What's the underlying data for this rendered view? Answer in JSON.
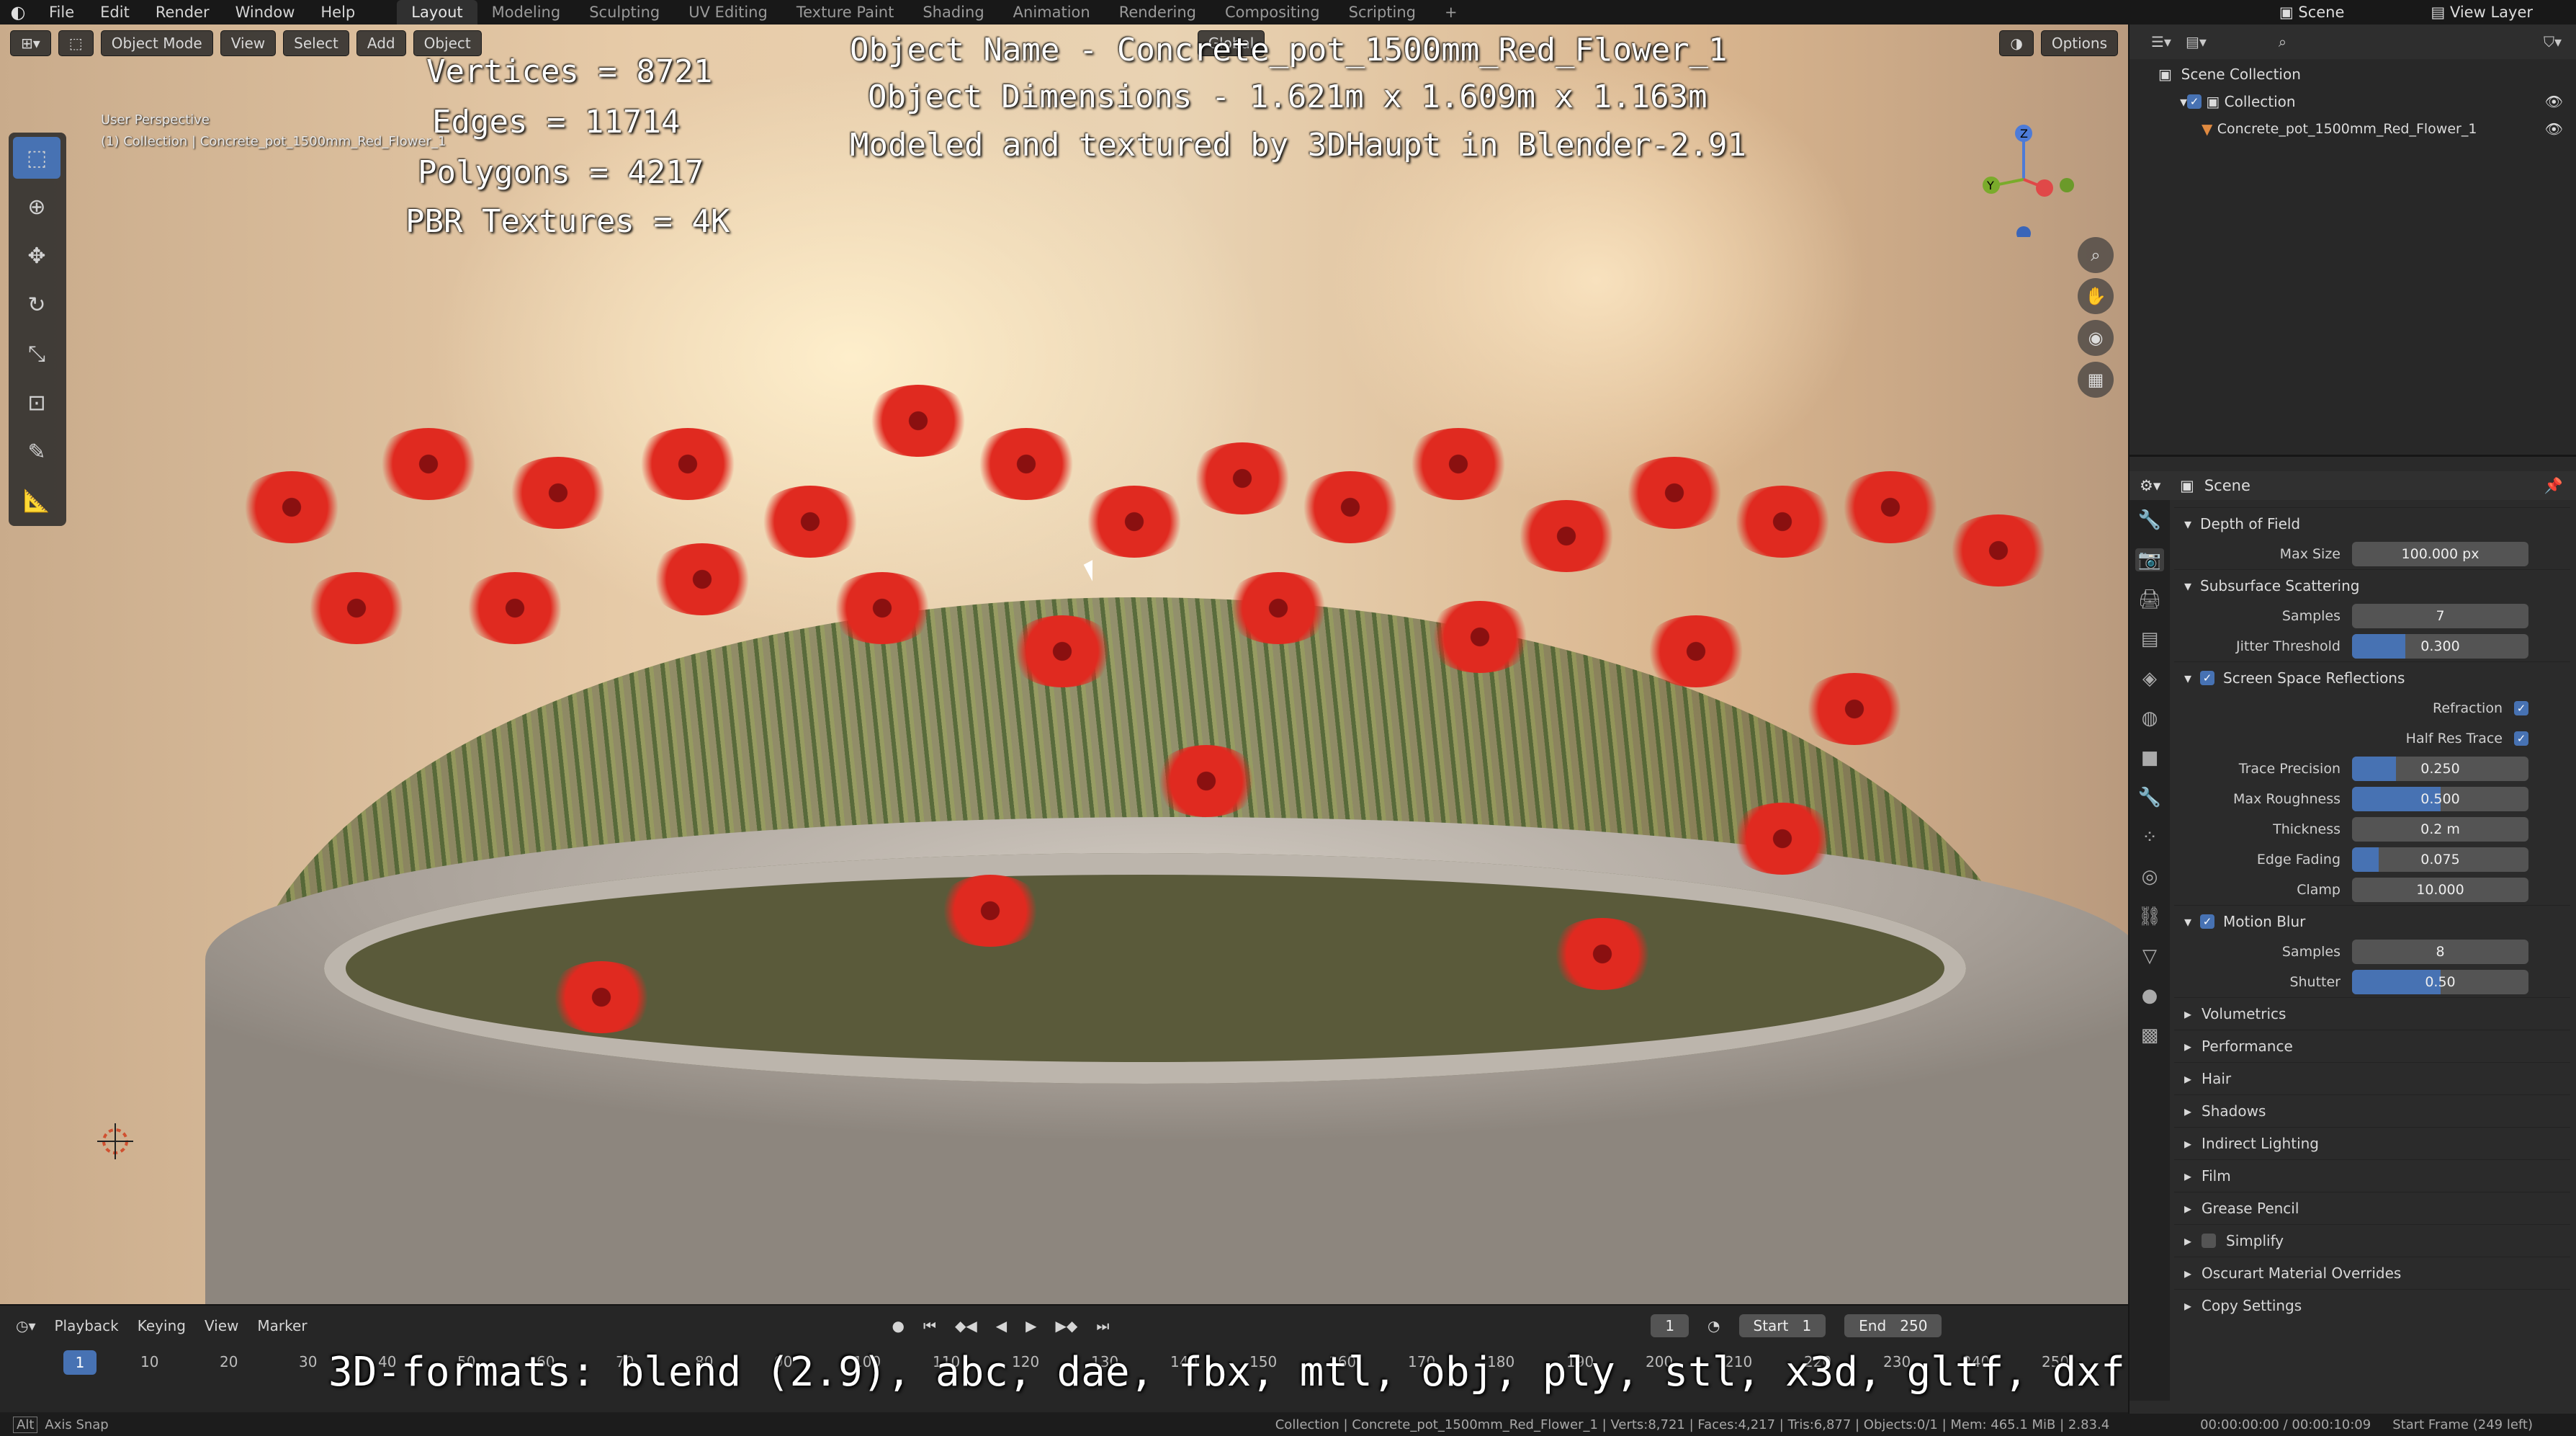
{
  "topbar": {
    "menus": [
      "File",
      "Edit",
      "Render",
      "Window",
      "Help"
    ],
    "workspaces": [
      "Layout",
      "Modeling",
      "Sculpting",
      "UV Editing",
      "Texture Paint",
      "Shading",
      "Animation",
      "Rendering",
      "Compositing",
      "Scripting"
    ],
    "active_workspace": "Layout",
    "scene_label": "Scene",
    "view_layer_label": "View Layer"
  },
  "viewport": {
    "mode": "Object Mode",
    "menus": [
      "View",
      "Select",
      "Add",
      "Object"
    ],
    "transform_orientation": "Global",
    "options_label": "Options",
    "perspective_label": "User Perspective",
    "collection_label": "(1) Collection | Concrete_pot_1500mm_Red_Flower_1"
  },
  "overlay": {
    "vertices": "Vertices = 8721",
    "edges": "Edges = 11714",
    "polygons": "Polygons = 4217",
    "textures": "PBR Textures = 4K",
    "object_name": "Object Name - Concrete_pot_1500mm_Red_Flower_1",
    "dimensions": "Object Dimensions -  1.621m x 1.609m x 1.163m",
    "credit": "Modeled and textured by 3DHaupt in Blender-2.91",
    "formats": "3D-formats: blend (2.9), abc, dae, fbx, mtl, obj, ply, stl, x3d, gltf, dxf"
  },
  "outliner": {
    "root": "Scene Collection",
    "collection": "Collection",
    "object": "Concrete_pot_1500mm_Red_Flower_1"
  },
  "properties": {
    "context": "Scene",
    "depth_of_field": {
      "title": "Depth of Field",
      "max_size_label": "Max Size",
      "max_size": "100.000 px"
    },
    "sss": {
      "title": "Subsurface Scattering",
      "samples_label": "Samples",
      "samples": "7",
      "jitter_label": "Jitter Threshold",
      "jitter": "0.300",
      "jitter_fraction": 0.3
    },
    "ssr": {
      "title": "Screen Space Reflections",
      "enabled": true,
      "refraction_label": "Refraction",
      "half_res_label": "Half Res Trace",
      "trace_precision_label": "Trace Precision",
      "trace_precision": "0.250",
      "trace_precision_fraction": 0.25,
      "max_roughness_label": "Max Roughness",
      "max_roughness": "0.500",
      "max_roughness_fraction": 0.5,
      "thickness_label": "Thickness",
      "thickness": "0.2 m",
      "edge_fading_label": "Edge Fading",
      "edge_fading": "0.075",
      "edge_fading_fraction": 0.15,
      "clamp_label": "Clamp",
      "clamp": "10.000"
    },
    "motion_blur": {
      "title": "Motion Blur",
      "enabled": true,
      "samples_label": "Samples",
      "samples": "8",
      "shutter_label": "Shutter",
      "shutter": "0.50",
      "shutter_fraction": 0.5
    },
    "collapsed": [
      "Volumetrics",
      "Performance",
      "Hair",
      "Shadows",
      "Indirect Lighting",
      "Film",
      "Grease Pencil",
      "Simplify",
      "Oscurart Material Overrides",
      "Copy Settings"
    ]
  },
  "timeline": {
    "menus": [
      "Playback",
      "Keying",
      "View",
      "Marker"
    ],
    "current_frame": "1",
    "start_label": "Start",
    "start": "1",
    "end_label": "End",
    "end": "250",
    "ticks": [
      "1",
      "10",
      "20",
      "30",
      "40",
      "50",
      "60",
      "70",
      "80",
      "90",
      "100",
      "110",
      "120",
      "130",
      "140",
      "150",
      "160",
      "170",
      "180",
      "190",
      "200",
      "210",
      "220",
      "230",
      "240",
      "250"
    ]
  },
  "status": {
    "left": "Axis Snap",
    "center": "Collection | Concrete_pot_1500mm_Red_Flower_1 | Verts:8,721 | Faces:4,217 | Tris:6,877 | Objects:0/1 | Mem: 465.1 MiB | 2.83.4",
    "time": "00:00:00:00 / 00:00:10:09",
    "right": "Start Frame (249 left)"
  },
  "colors": {
    "accent": "#4772b3",
    "panel": "#2b2b2b",
    "flower": "#e02a20"
  }
}
